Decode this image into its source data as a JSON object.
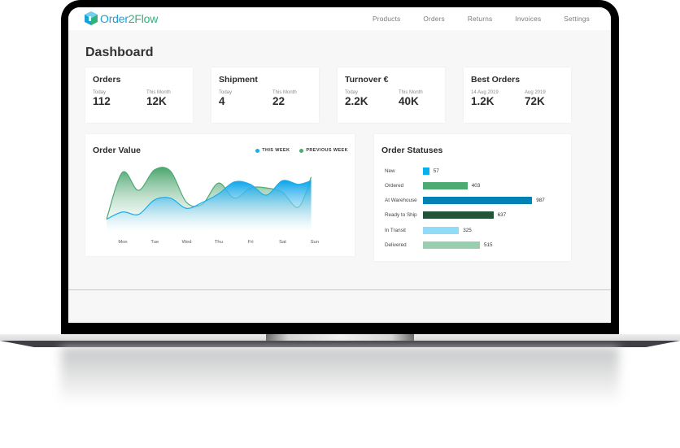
{
  "app": {
    "logo_part1": "Order",
    "logo_part2": "2",
    "logo_part3": "Flow",
    "nav": [
      "Products",
      "Orders",
      "Returns",
      "Invoices",
      "Settings"
    ]
  },
  "page": {
    "title": "Dashboard"
  },
  "kpis": [
    {
      "title": "Orders",
      "left_label": "Today",
      "left_value": "112",
      "right_label": "This Month",
      "right_value": "12K"
    },
    {
      "title": "Shipment",
      "left_label": "Today",
      "left_value": "4",
      "right_label": "This Month",
      "right_value": "22"
    },
    {
      "title": "Turnover €",
      "left_label": "Today",
      "left_value": "2.2K",
      "right_label": "This Month",
      "right_value": "40K"
    },
    {
      "title": "Best Orders",
      "left_label": "14 Aug 2019",
      "left_value": "1.2K",
      "right_label": "Aug 2019",
      "right_value": "72K"
    }
  ],
  "colors": {
    "this_week": "#1aaeea",
    "previous_week": "#4caa72",
    "brand_blue": "#1aa0d8",
    "brand_green": "#2fb37a"
  },
  "chart_data": [
    {
      "type": "area",
      "title": "Order Value",
      "categories": [
        "Mon",
        "Tue",
        "Wed",
        "Thu",
        "Fri",
        "Sat",
        "Sun"
      ],
      "legend": [
        "THIS WEEK",
        "PREVIOUS WEEK"
      ],
      "legend_position": "top-right",
      "ylim": [
        0,
        100
      ],
      "grid": false,
      "x_points": [
        0,
        0.5,
        1,
        1.5,
        2,
        2.5,
        3,
        3.5,
        4,
        4.5,
        5,
        5.5,
        6,
        6.4
      ],
      "series": [
        {
          "name": "THIS WEEK",
          "color": "#1aaeea",
          "values": [
            10,
            22,
            18,
            42,
            45,
            28,
            38,
            52,
            72,
            68,
            50,
            74,
            68,
            74
          ]
        },
        {
          "name": "PREVIOUS WEEK",
          "color": "#4caa72",
          "values": [
            10,
            88,
            58,
            92,
            90,
            38,
            35,
            70,
            45,
            62,
            62,
            55,
            30,
            80
          ]
        }
      ]
    },
    {
      "type": "bar",
      "orientation": "horizontal",
      "title": "Order Statuses",
      "categories": [
        "New",
        "Ordered",
        "At Warehouse",
        "Ready to Ship",
        "In Transit",
        "Delivered"
      ],
      "values": [
        57,
        403,
        987,
        637,
        325,
        515
      ],
      "colors": [
        "#09b1ec",
        "#4caa72",
        "#0282b4",
        "#235439",
        "#90dbf8",
        "#97cfaf"
      ],
      "xlim": [
        0,
        1000
      ]
    }
  ]
}
